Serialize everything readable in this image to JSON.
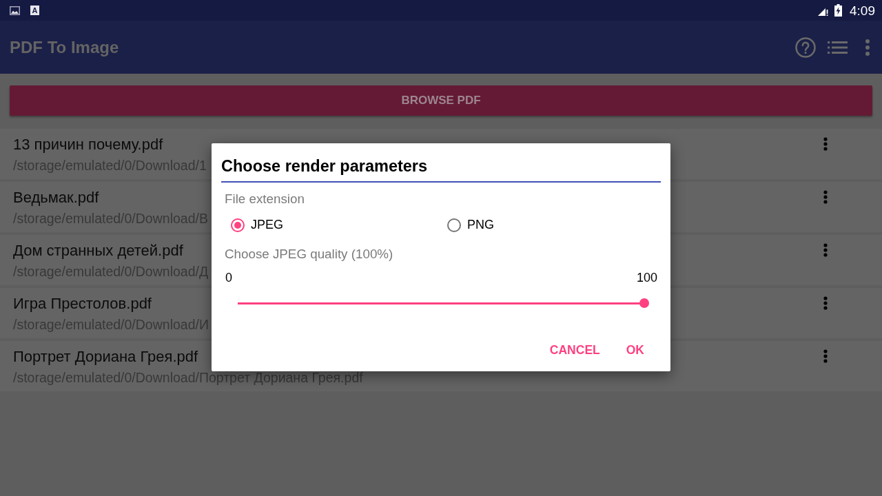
{
  "status_bar": {
    "notification_letter": "A",
    "time": "4:09"
  },
  "app_bar": {
    "title": "PDF To Image"
  },
  "browse_button": {
    "label": "BROWSE PDF"
  },
  "files": [
    {
      "name": "13 причин почему.pdf",
      "path": "/storage/emulated/0/Download/1"
    },
    {
      "name": "Ведьмак.pdf",
      "path": "/storage/emulated/0/Download/В"
    },
    {
      "name": "Дом странных детей.pdf",
      "path": "/storage/emulated/0/Download/Д"
    },
    {
      "name": "Игра Престолов.pdf",
      "path": "/storage/emulated/0/Download/И"
    },
    {
      "name": "Портрет Дориана Грея.pdf",
      "path": "/storage/emulated/0/Download/Портрет Дориана Грея.pdf"
    }
  ],
  "dialog": {
    "title": "Choose render parameters",
    "extension_label": "File extension",
    "extensions": [
      {
        "label": "JPEG",
        "selected": true
      },
      {
        "label": "PNG",
        "selected": false
      }
    ],
    "quality_label": "Choose JPEG quality (100%)",
    "slider": {
      "min_label": "0",
      "max_label": "100",
      "level": 1
    },
    "buttons": [
      "CANCEL",
      "OK"
    ]
  }
}
